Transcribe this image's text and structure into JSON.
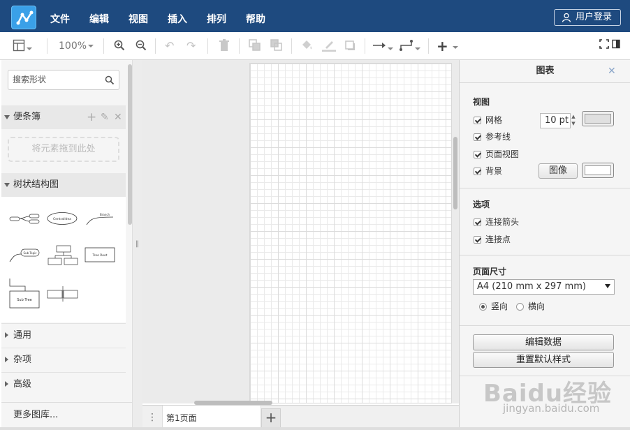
{
  "menubar": {
    "items": [
      "文件",
      "编辑",
      "视图",
      "插入",
      "排列",
      "帮助"
    ],
    "login_label": "用户登录"
  },
  "toolbar": {
    "zoom": "100%"
  },
  "sidebar": {
    "search_placeholder": "搜索形状",
    "scratchpad": {
      "title": "便条簿",
      "drop_hint": "将元素拖到此处"
    },
    "tree": {
      "title": "树状结构图",
      "shape_labels": [
        "Centralldea",
        "Branch",
        "Sub Topic",
        "Tree Root",
        "Sub Tree"
      ]
    },
    "sections": [
      "通用",
      "杂项",
      "高级"
    ],
    "more_label": "更多图库..."
  },
  "tabbar": {
    "page_tab": "第1页面"
  },
  "format_panel": {
    "title": "图表",
    "view": {
      "heading": "视图",
      "grid_label": "网格",
      "grid_size": "10 pt",
      "guides_label": "参考线",
      "page_view_label": "页面视图",
      "background_label": "背景",
      "image_button": "图像"
    },
    "options": {
      "heading": "选项",
      "connection_arrows": "连接箭头",
      "connection_points": "连接点"
    },
    "page_size": {
      "heading": "页面尺寸",
      "selected": "A4 (210 mm x 297 mm)",
      "portrait": "竖向",
      "landscape": "横向"
    },
    "buttons": {
      "edit_data": "编辑数据",
      "reset_style": "重置默认样式"
    }
  },
  "watermark": {
    "brand": "Baidu经验",
    "url": "jingyan.baidu.com"
  },
  "colors": {
    "menubar": "#1e4a7f",
    "logo": "#3aa0e8",
    "grid_swatch": "#e0e0e0",
    "background_swatch": "#ffffff"
  }
}
